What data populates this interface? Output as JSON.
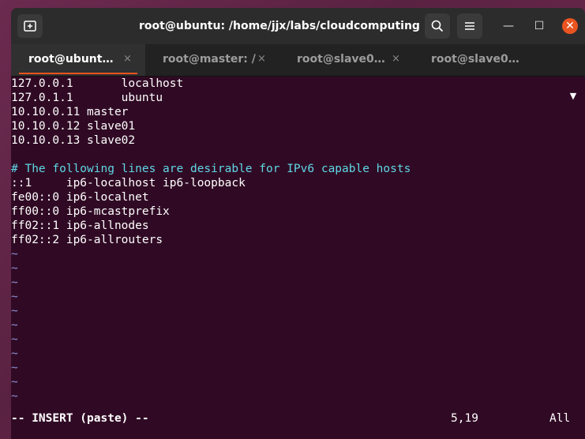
{
  "window": {
    "title": "root@ubuntu: /home/jjx/labs/cloudcomputing"
  },
  "controls": {
    "minimize": "—",
    "maximize": "☐",
    "close": "✕"
  },
  "tabs": [
    {
      "label": "root@ubunt…",
      "close": "×",
      "active": true
    },
    {
      "label": "root@master: /",
      "close": "×",
      "active": false
    },
    {
      "label": "root@slave0…",
      "close": "×",
      "active": false
    },
    {
      "label": "root@slave0…",
      "close": "×",
      "active": false
    }
  ],
  "tab_dropdown": "▼",
  "terminal": {
    "lines": [
      "127.0.0.1       localhost",
      "127.0.1.1       ubuntu",
      "10.10.0.11 master",
      "10.10.0.12 slave01",
      "10.10.0.13 slave02",
      "",
      "# The following lines are desirable for IPv6 capable hosts",
      "::1     ip6-localhost ip6-loopback",
      "fe00::0 ip6-localnet",
      "ff00::0 ip6-mcastprefix",
      "ff02::1 ip6-allnodes",
      "ff02::2 ip6-allrouters",
      "~",
      "~",
      "~",
      "~",
      "~",
      "~",
      "~",
      "~",
      "~",
      "~",
      "~"
    ],
    "status": {
      "mode": "-- INSERT (paste) --",
      "cursor": "5,19",
      "scroll": "All"
    }
  },
  "colors": {
    "terminal_bg": "#300a24",
    "comment": "#5fd7e6",
    "tilde": "#8f8fd6",
    "accent": "#e95420"
  },
  "icons": {
    "new_tab": "new-tab-icon",
    "search": "search-icon",
    "menu": "hamburger-menu-icon"
  }
}
